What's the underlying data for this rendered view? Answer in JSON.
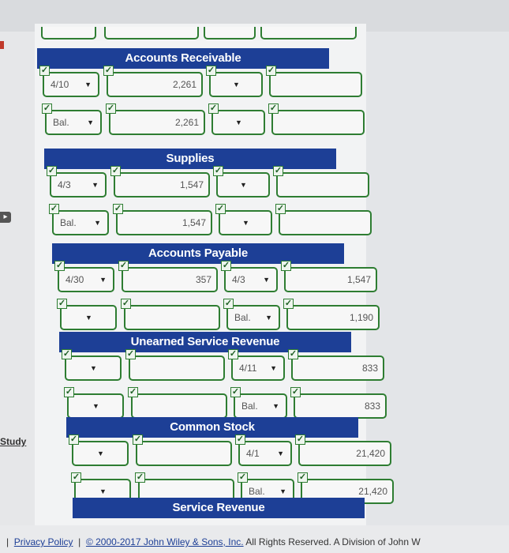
{
  "rail": {
    "study_label": "Study"
  },
  "sections": [
    {
      "title": "Accounts Receivable",
      "rows": [
        {
          "debit_account": "4/10",
          "debit_amount": "2,261",
          "credit_account": "",
          "credit_amount": ""
        },
        {
          "debit_account": "Bal.",
          "debit_amount": "2,261",
          "credit_account": "",
          "credit_amount": ""
        }
      ]
    },
    {
      "title": "Supplies",
      "rows": [
        {
          "debit_account": "4/3",
          "debit_amount": "1,547",
          "credit_account": "",
          "credit_amount": ""
        },
        {
          "debit_account": "Bal.",
          "debit_amount": "1,547",
          "credit_account": "",
          "credit_amount": ""
        }
      ]
    },
    {
      "title": "Accounts Payable",
      "rows": [
        {
          "debit_account": "4/30",
          "debit_amount": "357",
          "credit_account": "4/3",
          "credit_amount": "1,547"
        },
        {
          "debit_account": "",
          "debit_amount": "",
          "credit_account": "Bal.",
          "credit_amount": "1,190"
        }
      ]
    },
    {
      "title": "Unearned Service Revenue",
      "rows": [
        {
          "debit_account": "",
          "debit_amount": "",
          "credit_account": "4/11",
          "credit_amount": "833"
        },
        {
          "debit_account": "",
          "debit_amount": "",
          "credit_account": "Bal.",
          "credit_amount": "833"
        }
      ]
    },
    {
      "title": "Common Stock",
      "rows": [
        {
          "debit_account": "",
          "debit_amount": "",
          "credit_account": "4/1",
          "credit_amount": "21,420"
        },
        {
          "debit_account": "",
          "debit_amount": "",
          "credit_account": "Bal.",
          "credit_amount": "21,420"
        }
      ]
    },
    {
      "title": "Service Revenue",
      "rows": []
    }
  ],
  "footer": {
    "separator": "|",
    "privacy_link": "Privacy Policy",
    "copyright": "© 2000-2017 John Wiley & Sons, Inc.",
    "rights": "All Rights Reserved. A Division of John W"
  },
  "colors": {
    "header_blue": "#1d3f96",
    "cell_border_green": "#2e7d32"
  }
}
